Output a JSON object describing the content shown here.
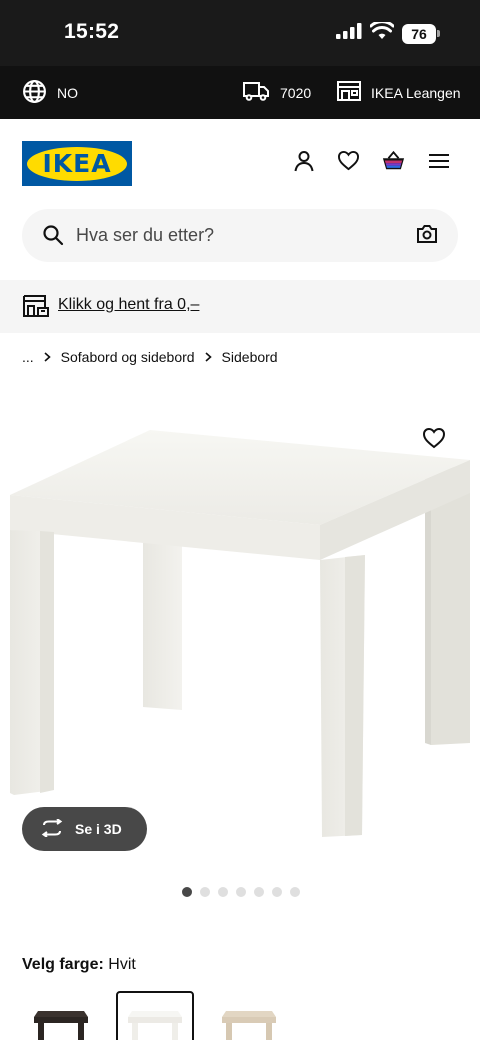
{
  "status_bar": {
    "time": "15:52",
    "battery": "76"
  },
  "info_bar": {
    "language": "NO",
    "zip": "7020",
    "store": "IKEA Leangen"
  },
  "header": {
    "logo_text": "IKEA"
  },
  "search": {
    "placeholder": "Hva ser du etter?"
  },
  "promo": {
    "text": "Klikk og hent fra 0,–"
  },
  "breadcrumb": {
    "ellipsis": "...",
    "items": [
      "Sofabord og sidebord",
      "Sidebord"
    ]
  },
  "product": {
    "view_3d_label": "Se i 3D",
    "carousel": {
      "total": 7,
      "active": 1
    },
    "color_heading": "Velg farge:",
    "color_value": "Hvit",
    "swatches": [
      {
        "name": "black-brown",
        "color": "#2b2522"
      },
      {
        "name": "white",
        "color": "#f2f2ef",
        "selected": true
      },
      {
        "name": "white-stained-oak",
        "color": "#d9cbb6"
      }
    ]
  }
}
